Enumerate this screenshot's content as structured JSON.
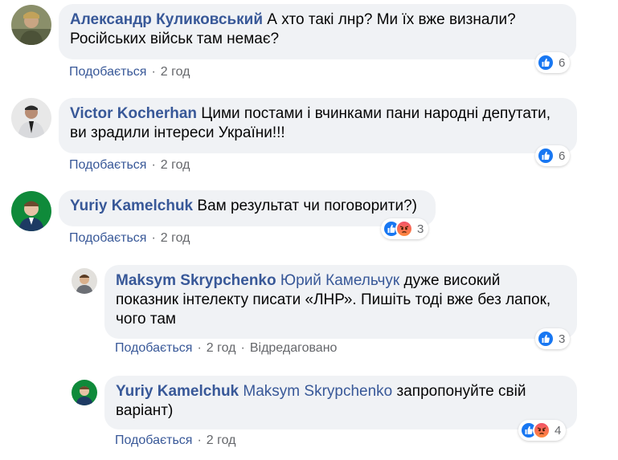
{
  "comments": [
    {
      "author": "Александр Куликовський",
      "text": " А хто такі лнр? Ми їх вже визнали? Російських військ там немає?",
      "reactions_count": "6",
      "like_label": "Подобається",
      "time": "2 год"
    },
    {
      "author": "Victor Kocherhan",
      "text": " Цими постами і вчинками пани народні депутати, ви зрадили інтереси України!!!",
      "reactions_count": "6",
      "like_label": "Подобається",
      "time": "2 год"
    },
    {
      "author": "Yuriy Kamelchuk",
      "text": " Вам результат чи поговорити?)",
      "reactions_count": "3",
      "like_label": "Подобається",
      "time": "2 год"
    }
  ],
  "replies": [
    {
      "author": "Maksym Skrypchenko",
      "mention": "Юрий Камельчук",
      "text": " дуже високий показник інтелекту писати «ЛНР». Пишіть тоді вже без лапок, чого там",
      "reactions_count": "3",
      "like_label": "Подобається",
      "time": "2 год",
      "edited": "Відредаговано"
    },
    {
      "author": "Yuriy Kamelchuk",
      "mention": "Maksym Skrypchenko",
      "text": " запропонуйте свій варіант)",
      "reactions_count": "4",
      "like_label": "Подобається",
      "time": "2 год"
    }
  ],
  "colors": {
    "bubble": "#f0f2f5",
    "name": "#385898",
    "like": "#1877f2",
    "meta": "#65676b"
  }
}
